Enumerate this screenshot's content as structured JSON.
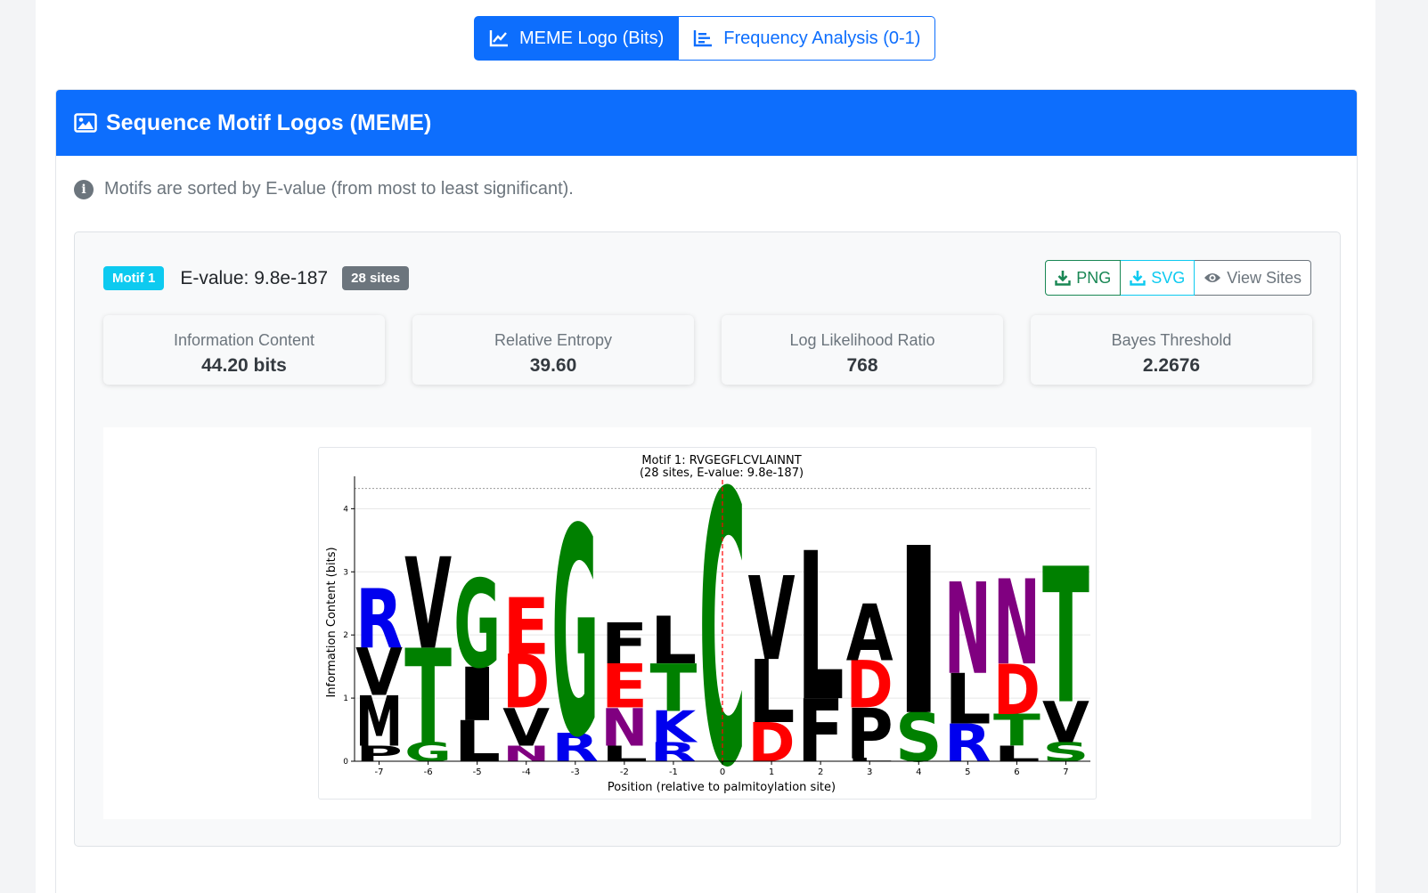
{
  "tabs": [
    {
      "label": "MEME Logo (Bits)",
      "icon": "line-chart-icon",
      "active": true
    },
    {
      "label": "Frequency Analysis (0-1)",
      "icon": "bar-chart-icon",
      "active": false
    }
  ],
  "card": {
    "title": "Sequence Motif Logos (MEME)",
    "icon": "image-icon",
    "note": "Motifs are sorted by E-value (from most to least significant)."
  },
  "motif": {
    "badge": "Motif 1",
    "evalue": "E-value: 9.8e-187",
    "sites": "28 sites",
    "buttons": {
      "png": "PNG",
      "svg": "SVG",
      "view": "View Sites"
    },
    "stats": [
      {
        "label": "Information Content",
        "value": "44.20 bits"
      },
      {
        "label": "Relative Entropy",
        "value": "39.60"
      },
      {
        "label": "Log Likelihood Ratio",
        "value": "768"
      },
      {
        "label": "Bayes Threshold",
        "value": "2.2676"
      }
    ]
  },
  "colors": {
    "primary": "#0d6efd",
    "info": "#0dcaf0",
    "success": "#198754",
    "secondary": "#6c757d",
    "aa_blue": "#0000ee",
    "aa_black": "#000000",
    "aa_green": "#008000",
    "aa_red": "#ff0000",
    "aa_purple": "#800080"
  },
  "chart_data": {
    "type": "sequence-logo",
    "title": "Motif 1: RVGEGFLCVLAINNT",
    "subtitle": "(28 sites, E-value: 9.8e-187)",
    "xlabel": "Position (relative to palmitoylation site)",
    "ylabel": "Information Content (bits)",
    "ylim": [
      0,
      4.4
    ],
    "yticks": [
      0,
      1,
      2,
      3,
      4
    ],
    "max_line": 4.32,
    "vline_position": 0,
    "grid": true,
    "positions": [
      {
        "pos": -7,
        "letters": [
          {
            "l": "P",
            "h": 0.25,
            "c": "black"
          },
          {
            "l": "M",
            "h": 0.8,
            "c": "black"
          },
          {
            "l": "V",
            "h": 0.75,
            "c": "black"
          },
          {
            "l": "R",
            "h": 0.95,
            "c": "blue"
          }
        ]
      },
      {
        "pos": -6,
        "letters": [
          {
            "l": "G",
            "h": 0.3,
            "c": "green"
          },
          {
            "l": "T",
            "h": 1.5,
            "c": "green"
          },
          {
            "l": "V",
            "h": 1.45,
            "c": "black"
          }
        ]
      },
      {
        "pos": -5,
        "letters": [
          {
            "l": "L",
            "h": 0.65,
            "c": "black"
          },
          {
            "l": "I",
            "h": 0.85,
            "c": "black"
          },
          {
            "l": "G",
            "h": 1.4,
            "c": "green"
          }
        ]
      },
      {
        "pos": -4,
        "letters": [
          {
            "l": "N",
            "h": 0.25,
            "c": "purple"
          },
          {
            "l": "V",
            "h": 0.6,
            "c": "black"
          },
          {
            "l": "D",
            "h": 0.85,
            "c": "red"
          },
          {
            "l": "E",
            "h": 0.9,
            "c": "red"
          }
        ]
      },
      {
        "pos": -3,
        "letters": [
          {
            "l": "R",
            "h": 0.45,
            "c": "blue"
          },
          {
            "l": "G",
            "h": 3.3,
            "c": "green"
          }
        ]
      },
      {
        "pos": -2,
        "letters": [
          {
            "l": "L",
            "h": 0.25,
            "c": "black"
          },
          {
            "l": "N",
            "h": 0.6,
            "c": "purple"
          },
          {
            "l": "E",
            "h": 0.7,
            "c": "red"
          },
          {
            "l": "F",
            "h": 0.65,
            "c": "black"
          }
        ]
      },
      {
        "pos": -1,
        "letters": [
          {
            "l": "R",
            "h": 0.3,
            "c": "blue"
          },
          {
            "l": "K",
            "h": 0.5,
            "c": "blue"
          },
          {
            "l": "T",
            "h": 0.75,
            "c": "green"
          },
          {
            "l": "L",
            "h": 0.75,
            "c": "black"
          }
        ]
      },
      {
        "pos": 0,
        "letters": [
          {
            "l": "C",
            "h": 4.32,
            "c": "green"
          }
        ]
      },
      {
        "pos": 1,
        "letters": [
          {
            "l": "D",
            "h": 0.62,
            "c": "red"
          },
          {
            "l": "L",
            "h": 1.0,
            "c": "black"
          },
          {
            "l": "V",
            "h": 1.33,
            "c": "black"
          }
        ]
      },
      {
        "pos": 2,
        "letters": [
          {
            "l": "F",
            "h": 1.0,
            "c": "black"
          },
          {
            "l": "L",
            "h": 2.35,
            "c": "black"
          }
        ]
      },
      {
        "pos": 3,
        "letters": [
          {
            "l": "L",
            "h": 0.05,
            "c": "black"
          },
          {
            "l": "P",
            "h": 0.8,
            "c": "black"
          },
          {
            "l": "D",
            "h": 0.75,
            "c": "red"
          },
          {
            "l": "A",
            "h": 0.9,
            "c": "black"
          }
        ]
      },
      {
        "pos": 4,
        "letters": [
          {
            "l": "S",
            "h": 0.78,
            "c": "green"
          },
          {
            "l": "I",
            "h": 2.65,
            "c": "black"
          }
        ]
      },
      {
        "pos": 5,
        "letters": [
          {
            "l": "R",
            "h": 0.6,
            "c": "blue"
          },
          {
            "l": "L",
            "h": 0.8,
            "c": "black"
          },
          {
            "l": "N",
            "h": 1.45,
            "c": "purple"
          }
        ]
      },
      {
        "pos": 6,
        "letters": [
          {
            "l": "L",
            "h": 0.25,
            "c": "black"
          },
          {
            "l": "T",
            "h": 0.5,
            "c": "green"
          },
          {
            "l": "D",
            "h": 0.8,
            "c": "red"
          },
          {
            "l": "N",
            "h": 1.35,
            "c": "purple"
          }
        ]
      },
      {
        "pos": 7,
        "letters": [
          {
            "l": "S",
            "h": 0.3,
            "c": "green"
          },
          {
            "l": "V",
            "h": 0.65,
            "c": "black"
          },
          {
            "l": "T",
            "h": 2.15,
            "c": "green"
          }
        ]
      }
    ]
  }
}
